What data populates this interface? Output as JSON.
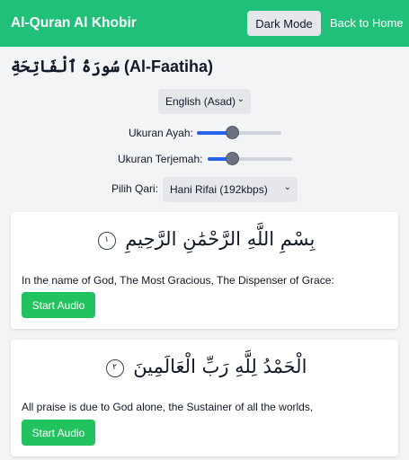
{
  "header": {
    "brand": "Al-Quran Al Khobir",
    "dark_mode_label": "Dark Mode",
    "back_home_label": "Back to Home",
    "bg_color": "#21c07a"
  },
  "surah": {
    "title": "سُورَةُ ٱلْفَاتِحَةِ (Al-Faatiha)"
  },
  "controls": {
    "language_selected": "English (Asad)",
    "ayah_size_label": "Ukuran Ayah:",
    "ayah_size_value": 0.42,
    "translation_size_label": "Ukuran Terjemah:",
    "translation_size_value": 0.29,
    "qari_label": "Pilih Qari:",
    "qari_selected": "Hani Rifai (192kbps)"
  },
  "ayahs": [
    {
      "arabic": "بِسْمِ اللَّهِ الرَّحْمَٰنِ الرَّحِيمِ",
      "number": "١",
      "translation": "In the name of God, The Most Gracious, The Dispenser of Grace:",
      "audio_label": "Start Audio"
    },
    {
      "arabic": "الْحَمْدُ لِلَّهِ رَبِّ الْعَالَمِينَ",
      "number": "٢",
      "translation": "All praise is due to God alone, the Sustainer of all the worlds,",
      "audio_label": "Start Audio"
    }
  ]
}
